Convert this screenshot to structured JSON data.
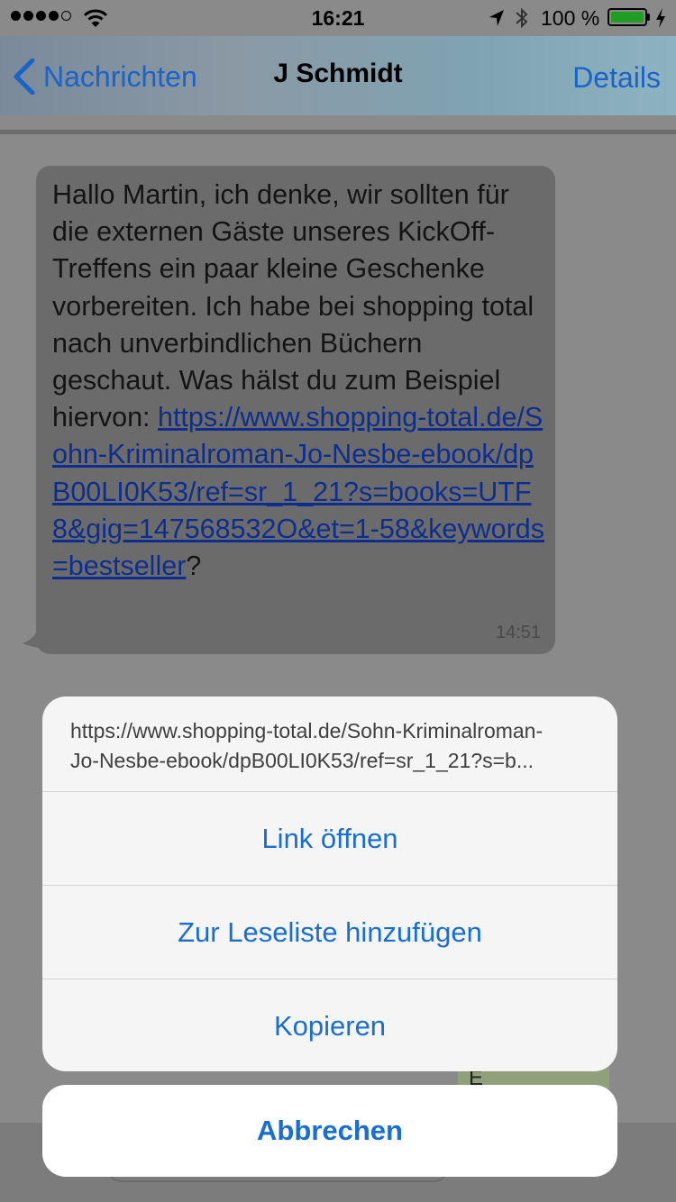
{
  "status_bar": {
    "time": "16:21",
    "battery": "100 %",
    "battery_level": 1.0
  },
  "nav": {
    "back_label": "Nachrichten",
    "title": "J Schmidt",
    "details_label": "Details"
  },
  "message": {
    "text": "Hallo Martin, ich denke, wir sollten für die externen Gäste unseres KickOff-Treffens ein paar kleine Geschenke vorbereiten. Ich habe bei shopping total nach unverbindlichen Büchern geschaut. Was hälst du zum Beispiel hiervon: ",
    "link": "https://www.shopping-total.de/Sohn-Kriminalroman-Jo-Nesbe-ebook/dpB00LI0K53/ref=sr_1_21?s=books=UTF8&gig=147568532O&et=1-58&keywords=bestseller",
    "suffix": "?",
    "time": "14:51"
  },
  "background": {
    "partial_letter": "E"
  },
  "action_sheet": {
    "url_line1": "https://www.shopping-total.de/Sohn-Kriminalroman-",
    "url_line2": "Jo-Nesbe-ebook/dpB00LI0K53/ref=sr_1_21?s=b...",
    "open_label": "Link öffnen",
    "reading_list_label": "Zur Leseliste hinzufügen",
    "copy_label": "Kopieren",
    "cancel_label": "Abbrechen"
  },
  "colors": {
    "accent": "#1a6ed0",
    "link": "#0e2e8f",
    "bubble": "#6b6b6b",
    "battery": "#1f9e23"
  },
  "icons": [
    "cellular-signal-icon",
    "wifi-icon",
    "location-arrow-icon",
    "bluetooth-icon",
    "battery-icon",
    "charging-bolt-icon",
    "chevron-left-icon"
  ]
}
